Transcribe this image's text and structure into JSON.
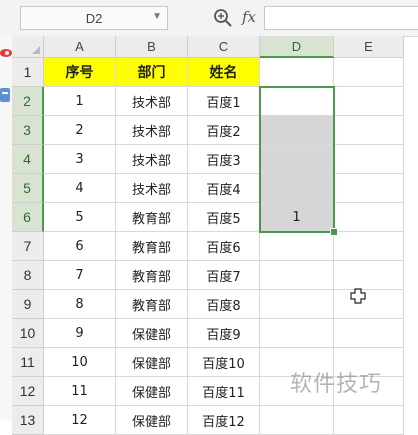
{
  "formula_bar": {
    "name_box": "D2",
    "fx_label": "fx",
    "formula_value": ""
  },
  "columns": [
    "A",
    "B",
    "C",
    "D",
    "E"
  ],
  "active_column": "D",
  "rows": [
    {
      "num": "1",
      "cells": [
        "序号",
        "部门",
        "姓名",
        "",
        ""
      ],
      "header": true
    },
    {
      "num": "2",
      "cells": [
        "1",
        "技术部",
        "百度1",
        "",
        ""
      ]
    },
    {
      "num": "3",
      "cells": [
        "2",
        "技术部",
        "百度2",
        "",
        ""
      ]
    },
    {
      "num": "4",
      "cells": [
        "3",
        "技术部",
        "百度3",
        "",
        ""
      ]
    },
    {
      "num": "5",
      "cells": [
        "4",
        "技术部",
        "百度4",
        "",
        ""
      ]
    },
    {
      "num": "6",
      "cells": [
        "5",
        "教育部",
        "百度5",
        "1",
        ""
      ]
    },
    {
      "num": "7",
      "cells": [
        "6",
        "教育部",
        "百度6",
        "",
        ""
      ]
    },
    {
      "num": "8",
      "cells": [
        "7",
        "教育部",
        "百度7",
        "",
        ""
      ]
    },
    {
      "num": "9",
      "cells": [
        "8",
        "教育部",
        "百度8",
        "",
        ""
      ]
    },
    {
      "num": "10",
      "cells": [
        "9",
        "保健部",
        "百度9",
        "",
        ""
      ]
    },
    {
      "num": "11",
      "cells": [
        "10",
        "保健部",
        "百度10",
        "",
        ""
      ]
    },
    {
      "num": "12",
      "cells": [
        "11",
        "保健部",
        "百度11",
        "",
        ""
      ]
    },
    {
      "num": "13",
      "cells": [
        "12",
        "保健部",
        "百度12",
        "",
        ""
      ]
    }
  ],
  "selection": {
    "range": "D2:D6",
    "active_cell": "D2"
  },
  "icons": {
    "zoom": "zoom-icon",
    "function": "fx-icon",
    "cursor": "cell-cursor-icon"
  },
  "colors": {
    "header_fill": "#ffff00",
    "selection_border": "#4a9a4a",
    "selection_fill": "#d6d6d6"
  },
  "watermark": "软件技巧"
}
